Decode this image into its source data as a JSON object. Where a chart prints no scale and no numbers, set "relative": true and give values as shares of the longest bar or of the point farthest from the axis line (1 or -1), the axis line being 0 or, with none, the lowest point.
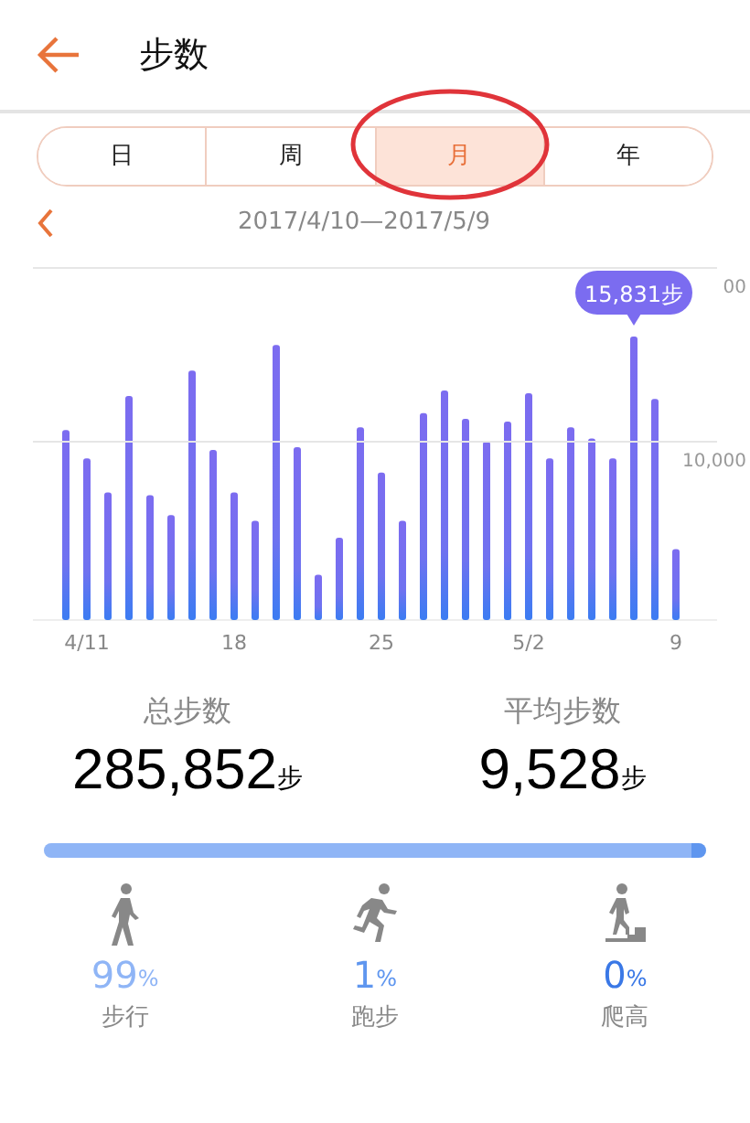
{
  "header": {
    "title": "步数"
  },
  "tabs": [
    {
      "label": "日",
      "selected": false
    },
    {
      "label": "周",
      "selected": false
    },
    {
      "label": "月",
      "selected": true
    },
    {
      "label": "年",
      "selected": false
    }
  ],
  "date_range": "2017/4/10—2017/5/9",
  "chart_data": {
    "type": "bar",
    "relative": true,
    "categories": [
      null,
      "4/11",
      null,
      null,
      null,
      null,
      null,
      null,
      "18",
      null,
      null,
      null,
      null,
      null,
      null,
      "25",
      null,
      null,
      null,
      null,
      null,
      null,
      "5/2",
      null,
      null,
      null,
      null,
      null,
      null,
      "9"
    ],
    "values": [
      0.67,
      0.57,
      0.45,
      0.79,
      0.44,
      0.37,
      0.88,
      0.6,
      0.45,
      0.35,
      0.97,
      0.61,
      0.16,
      0.29,
      0.68,
      0.52,
      0.35,
      0.73,
      0.81,
      0.71,
      0.63,
      0.7,
      0.8,
      0.57,
      0.68,
      0.64,
      0.57,
      1,
      0.78,
      0.25
    ],
    "annotations": [
      "15,831步"
    ]
  },
  "chart_axis_labels": [
    "00",
    "10,000"
  ],
  "stats": [
    {
      "label": "总步数",
      "value": "285,852",
      "unit": "步"
    },
    {
      "label": "平均步数",
      "value": "9,528",
      "unit": "步"
    }
  ],
  "activities": [
    {
      "kind": "walk",
      "percent": "99",
      "unit": "%",
      "label": "步行",
      "level": 0.99,
      "color": "#8fb5f6"
    },
    {
      "kind": "run",
      "percent": "1",
      "unit": "%",
      "label": "跑步",
      "level": 0.01,
      "color": "#5f96ef"
    },
    {
      "kind": "climb",
      "percent": "0",
      "unit": "%",
      "label": "爬高",
      "color": "#3a78e6"
    }
  ]
}
